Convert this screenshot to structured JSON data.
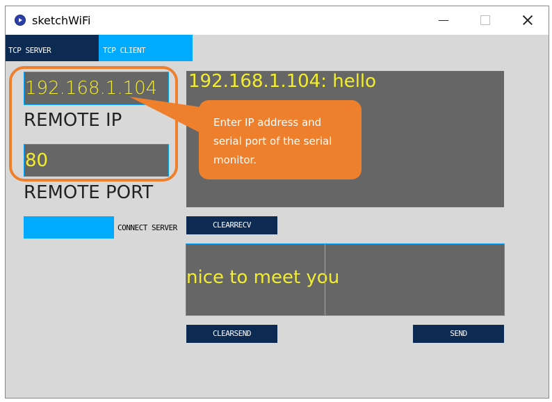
{
  "window": {
    "title": "sketchWiFi"
  },
  "tabs": {
    "server": "TCP SERVER",
    "client": "TCP CLIENT"
  },
  "connection": {
    "remote_ip_value": "192.168.1.104",
    "remote_ip_label": "REMOTE IP",
    "remote_port_value": "80",
    "remote_port_label": "REMOTE PORT",
    "connect_label": "CONNECT SERVER"
  },
  "receive": {
    "text": "192.168.1.104:  hello",
    "clear_label": "CLEARRECV"
  },
  "send": {
    "text": "nice to meet you",
    "clear_label": "CLEARSEND",
    "send_label": "SEND"
  },
  "annotation": {
    "line1": "Enter IP address and",
    "line2": "serial port of the serial",
    "line3": "monitor."
  },
  "colors": {
    "accent_blue": "#00aaff",
    "navy": "#0c2a52",
    "field_bg": "#666666",
    "field_text": "#f2ed2f",
    "annotation_orange": "#ee7f2d"
  }
}
